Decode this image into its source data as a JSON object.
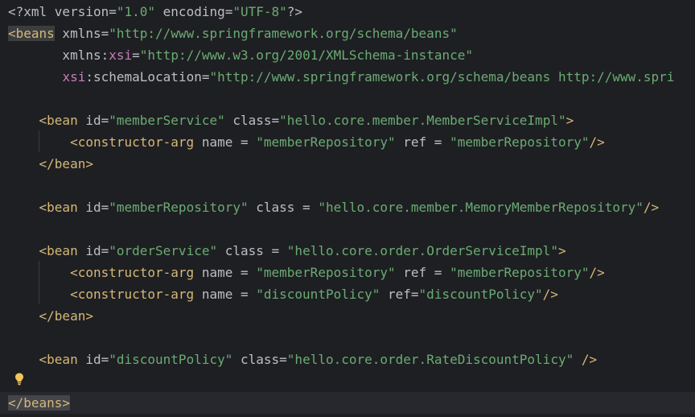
{
  "editor": {
    "language": "xml",
    "colors": {
      "background": "#1e1f22",
      "tag": "#d5b778",
      "attribute": "#bcbec4",
      "namespace": "#c77dbb",
      "string": "#6aab73"
    },
    "current_line": 19,
    "gutter_icon": "lightbulb-icon",
    "lines": [
      [
        {
          "t": "<?xml version=",
          "c": "punct"
        },
        {
          "t": "\"1.0\"",
          "c": "str"
        },
        {
          "t": " encoding=",
          "c": "attr"
        },
        {
          "t": "\"UTF-8\"",
          "c": "str"
        },
        {
          "t": "?>",
          "c": "punct"
        }
      ],
      [
        {
          "t": "<beans",
          "c": "tag",
          "hl": true
        },
        {
          "t": " xmlns=",
          "c": "attr"
        },
        {
          "t": "\"http://www.springframework.org/schema/beans\"",
          "c": "str"
        }
      ],
      [
        {
          "t": "       xmlns:",
          "c": "attr"
        },
        {
          "t": "xsi",
          "c": "ns"
        },
        {
          "t": "=",
          "c": "attr"
        },
        {
          "t": "\"http://www.w3.org/2001/XMLSchema-instance\"",
          "c": "str"
        }
      ],
      [
        {
          "t": "       ",
          "c": "attr"
        },
        {
          "t": "xsi",
          "c": "ns"
        },
        {
          "t": ":schemaLocation=",
          "c": "attr"
        },
        {
          "t": "\"http://www.springframework.org/schema/beans http://www.spri",
          "c": "str"
        }
      ],
      [],
      [
        {
          "t": "    <bean",
          "c": "tag"
        },
        {
          "t": " id=",
          "c": "attr"
        },
        {
          "t": "\"memberService\"",
          "c": "str"
        },
        {
          "t": " class=",
          "c": "attr"
        },
        {
          "t": "\"hello.core.member.MemberServiceImpl\"",
          "c": "str"
        },
        {
          "t": ">",
          "c": "tag"
        }
      ],
      [
        {
          "t": "        <constructor-arg",
          "c": "tag"
        },
        {
          "t": " name = ",
          "c": "attr"
        },
        {
          "t": "\"memberRepository\"",
          "c": "str"
        },
        {
          "t": " ref = ",
          "c": "attr"
        },
        {
          "t": "\"memberRepository\"",
          "c": "str"
        },
        {
          "t": "/>",
          "c": "tag"
        }
      ],
      [
        {
          "t": "    </bean>",
          "c": "tag"
        }
      ],
      [],
      [
        {
          "t": "    <bean",
          "c": "tag"
        },
        {
          "t": " id=",
          "c": "attr"
        },
        {
          "t": "\"memberRepository\"",
          "c": "str"
        },
        {
          "t": " class = ",
          "c": "attr"
        },
        {
          "t": "\"hello.core.member.MemoryMemberRepository\"",
          "c": "str"
        },
        {
          "t": "/>",
          "c": "tag"
        }
      ],
      [],
      [
        {
          "t": "    <bean",
          "c": "tag"
        },
        {
          "t": " id=",
          "c": "attr"
        },
        {
          "t": "\"orderService\"",
          "c": "str"
        },
        {
          "t": " class = ",
          "c": "attr"
        },
        {
          "t": "\"hello.core.order.OrderServiceImpl\"",
          "c": "str"
        },
        {
          "t": ">",
          "c": "tag"
        }
      ],
      [
        {
          "t": "        <constructor-arg",
          "c": "tag"
        },
        {
          "t": " name = ",
          "c": "attr"
        },
        {
          "t": "\"memberRepository\"",
          "c": "str"
        },
        {
          "t": " ref = ",
          "c": "attr"
        },
        {
          "t": "\"memberRepository\"",
          "c": "str"
        },
        {
          "t": "/>",
          "c": "tag"
        }
      ],
      [
        {
          "t": "        <constructor-arg",
          "c": "tag"
        },
        {
          "t": " name = ",
          "c": "attr"
        },
        {
          "t": "\"discountPolicy\"",
          "c": "str"
        },
        {
          "t": " ref=",
          "c": "attr"
        },
        {
          "t": "\"discountPolicy\"",
          "c": "str"
        },
        {
          "t": "/>",
          "c": "tag"
        }
      ],
      [
        {
          "t": "    </bean>",
          "c": "tag"
        }
      ],
      [],
      [
        {
          "t": "    <bean",
          "c": "tag"
        },
        {
          "t": " id=",
          "c": "attr"
        },
        {
          "t": "\"discountPolicy\"",
          "c": "str"
        },
        {
          "t": " class=",
          "c": "attr"
        },
        {
          "t": "\"hello.core.order.RateDiscountPolicy\"",
          "c": "str"
        },
        {
          "t": " />",
          "c": "tag"
        }
      ],
      [],
      [
        {
          "t": "</beans>",
          "c": "tag",
          "hl": true
        }
      ]
    ]
  }
}
